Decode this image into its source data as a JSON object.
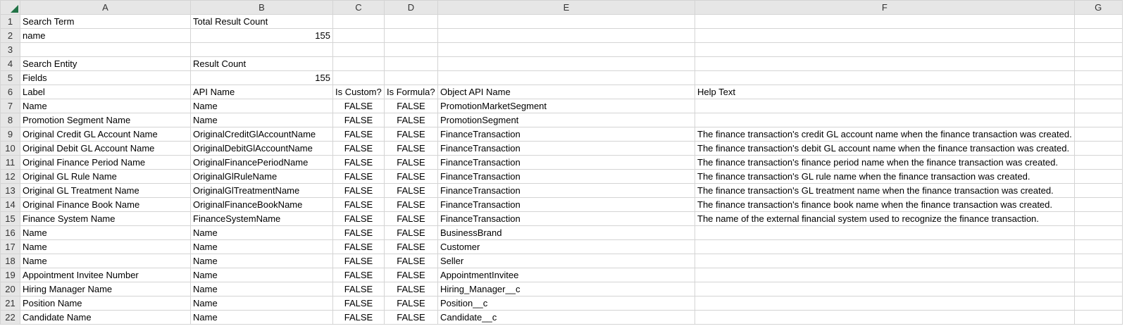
{
  "columns": [
    "A",
    "B",
    "C",
    "D",
    "E",
    "F",
    "G"
  ],
  "rows": [
    {
      "n": "1",
      "cells": [
        "Search Term",
        "Total Result Count",
        "",
        "",
        "",
        "",
        ""
      ]
    },
    {
      "n": "2",
      "cells": [
        "name",
        "155",
        "",
        "",
        "",
        "",
        ""
      ]
    },
    {
      "n": "3",
      "cells": [
        "",
        "",
        "",
        "",
        "",
        "",
        ""
      ]
    },
    {
      "n": "4",
      "cells": [
        "Search Entity",
        "Result Count",
        "",
        "",
        "",
        "",
        ""
      ]
    },
    {
      "n": "5",
      "cells": [
        "Fields",
        "155",
        "",
        "",
        "",
        "",
        ""
      ]
    },
    {
      "n": "6",
      "cells": [
        "Label",
        "API Name",
        "Is Custom?",
        "Is Formula?",
        "Object API Name",
        "Help Text",
        ""
      ]
    },
    {
      "n": "7",
      "cells": [
        "Name",
        "Name",
        "FALSE",
        "FALSE",
        "PromotionMarketSegment",
        "",
        ""
      ]
    },
    {
      "n": "8",
      "cells": [
        "Promotion Segment Name",
        "Name",
        "FALSE",
        "FALSE",
        "PromotionSegment",
        "",
        ""
      ]
    },
    {
      "n": "9",
      "cells": [
        "Original Credit GL Account Name",
        "OriginalCreditGlAccountName",
        "FALSE",
        "FALSE",
        "FinanceTransaction",
        "The finance transaction's credit GL account name when the finance transaction was created.",
        ""
      ]
    },
    {
      "n": "10",
      "cells": [
        "Original Debit GL Account Name",
        "OriginalDebitGlAccountName",
        "FALSE",
        "FALSE",
        "FinanceTransaction",
        "The finance transaction's debit GL account name when the finance transaction was created.",
        ""
      ]
    },
    {
      "n": "11",
      "cells": [
        "Original Finance Period Name",
        "OriginalFinancePeriodName",
        "FALSE",
        "FALSE",
        "FinanceTransaction",
        "The finance transaction's finance period name when the finance transaction was created.",
        ""
      ]
    },
    {
      "n": "12",
      "cells": [
        "Original GL Rule Name",
        "OriginalGlRuleName",
        "FALSE",
        "FALSE",
        "FinanceTransaction",
        "The finance transaction's GL rule name when the finance transaction was created.",
        ""
      ]
    },
    {
      "n": "13",
      "cells": [
        "Original GL Treatment Name",
        "OriginalGlTreatmentName",
        "FALSE",
        "FALSE",
        "FinanceTransaction",
        "The finance transaction's GL treatment name when the finance transaction was created.",
        ""
      ]
    },
    {
      "n": "14",
      "cells": [
        "Original Finance Book Name",
        "OriginalFinanceBookName",
        "FALSE",
        "FALSE",
        "FinanceTransaction",
        "The finance transaction's finance book name when the finance transaction was created.",
        ""
      ]
    },
    {
      "n": "15",
      "cells": [
        "Finance System Name",
        "FinanceSystemName",
        "FALSE",
        "FALSE",
        "FinanceTransaction",
        "The name of the external financial system used to recognize the finance transaction.",
        ""
      ]
    },
    {
      "n": "16",
      "cells": [
        "Name",
        "Name",
        "FALSE",
        "FALSE",
        "BusinessBrand",
        "",
        ""
      ]
    },
    {
      "n": "17",
      "cells": [
        "Name",
        "Name",
        "FALSE",
        "FALSE",
        "Customer",
        "",
        ""
      ]
    },
    {
      "n": "18",
      "cells": [
        "Name",
        "Name",
        "FALSE",
        "FALSE",
        "Seller",
        "",
        ""
      ]
    },
    {
      "n": "19",
      "cells": [
        "Appointment Invitee Number",
        "Name",
        "FALSE",
        "FALSE",
        "AppointmentInvitee",
        "",
        ""
      ]
    },
    {
      "n": "20",
      "cells": [
        "Hiring Manager  Name",
        "Name",
        "FALSE",
        "FALSE",
        "Hiring_Manager__c",
        "",
        ""
      ]
    },
    {
      "n": "21",
      "cells": [
        "Position  Name",
        "Name",
        "FALSE",
        "FALSE",
        "Position__c",
        "",
        ""
      ]
    },
    {
      "n": "22",
      "cells": [
        "Candidate Name",
        "Name",
        "FALSE",
        "FALSE",
        "Candidate__c",
        "",
        ""
      ]
    }
  ]
}
